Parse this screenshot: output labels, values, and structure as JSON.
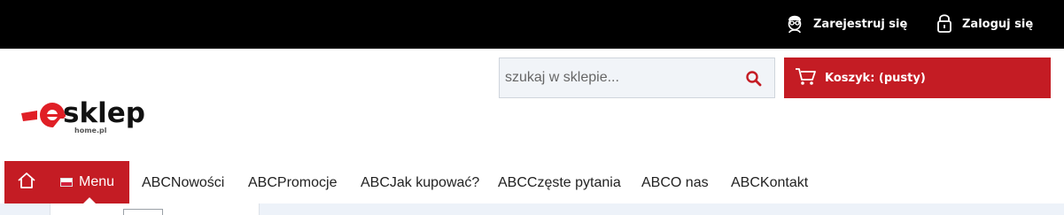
{
  "topbar": {
    "register_label": "Zarejestruj się",
    "login_label": "Zaloguj się",
    "register_icon": "user-glasses-icon",
    "login_icon": "padlock-icon"
  },
  "logo": {
    "main_text": "sklep",
    "sub_text": "home.pl"
  },
  "search": {
    "placeholder": "szukaj w sklepie...",
    "value": ""
  },
  "cart": {
    "label": "Koszyk: (pusty)"
  },
  "nav": {
    "menu_label": "Menu",
    "items": [
      "ABCNowości",
      "ABCPromocje",
      "ABCJak kupować?",
      "ABCCzęste pytania",
      "ABCO nas",
      "ABCKontakt"
    ]
  },
  "colors": {
    "topbar": "#000000",
    "accent": "#c41c24",
    "search_bg": "#f1f4f8"
  }
}
